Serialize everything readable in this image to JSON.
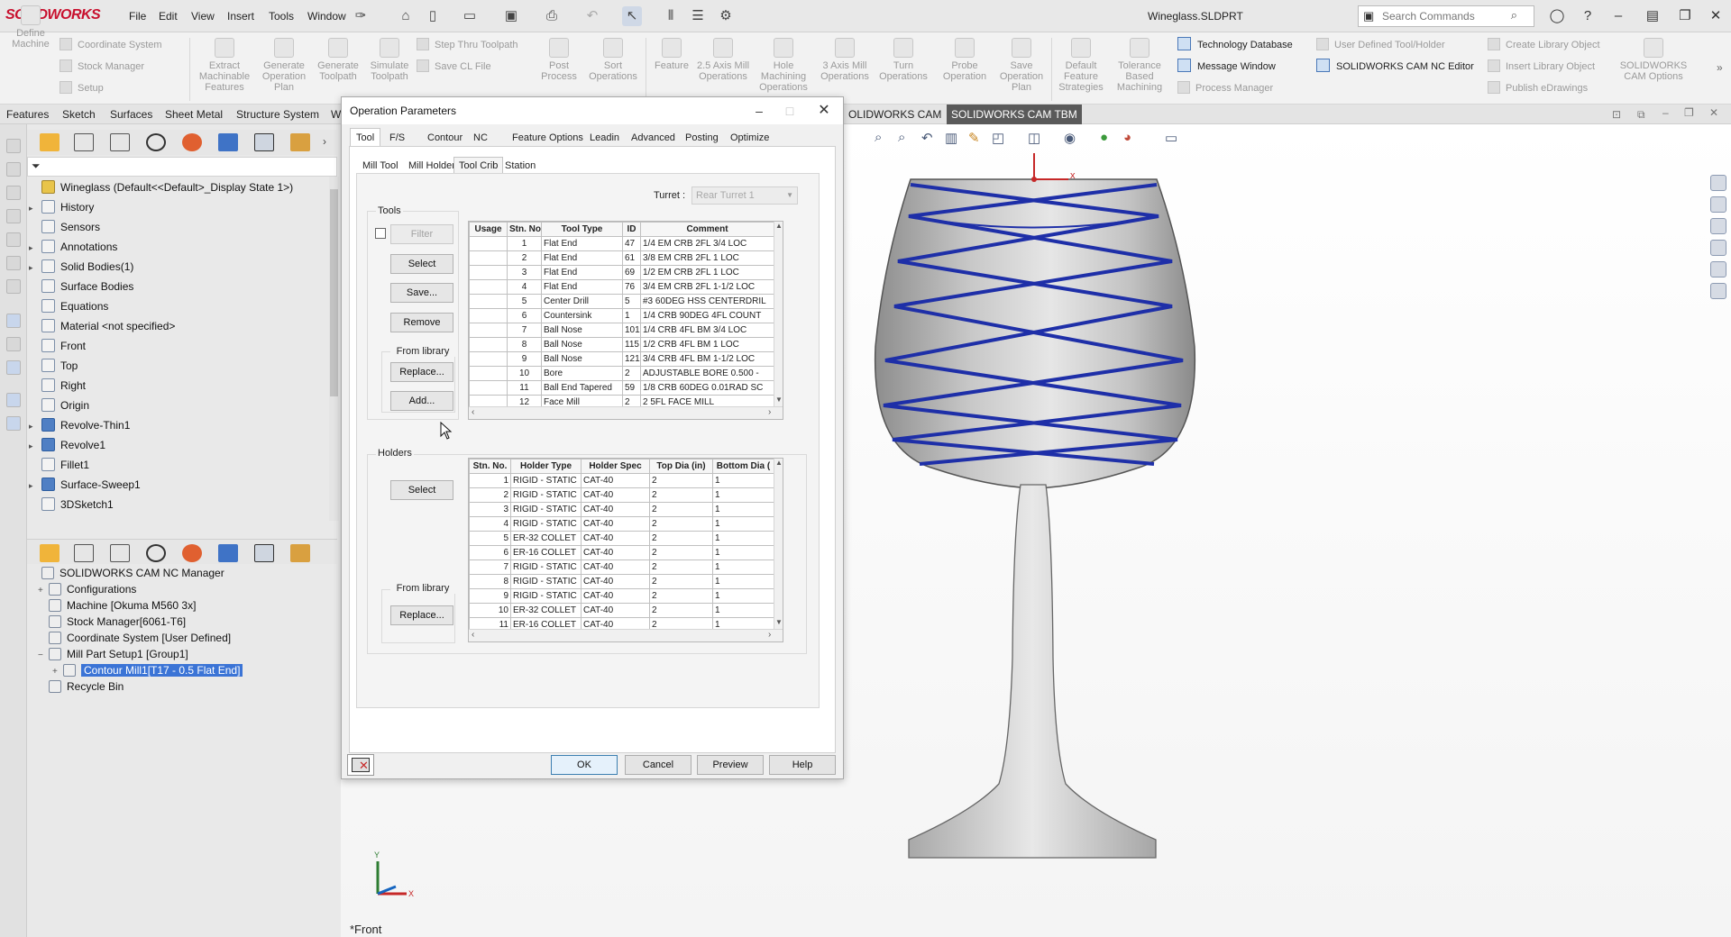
{
  "app": {
    "logo": "SOLIDWORKS",
    "file_title": "Wineglass.SLDPRT",
    "search_placeholder": "Search Commands"
  },
  "menu": [
    "File",
    "Edit",
    "View",
    "Insert",
    "Tools",
    "Window"
  ],
  "ribbon": {
    "define_machine": "Define Machine",
    "coord_system": "Coordinate System",
    "stock_manager": "Stock Manager",
    "setup": "Setup",
    "extract": "Extract Machinable Features",
    "gen_plan": "Generate Operation Plan",
    "gen_toolpath": "Generate Toolpath",
    "sim_toolpath": "Simulate Toolpath",
    "step_thru": "Step Thru Toolpath",
    "save_cl": "Save CL File",
    "post": "Post Process",
    "sort": "Sort Operations",
    "feature": "Feature",
    "mill25": "2.5 Axis Mill Operations",
    "hole": "Hole Machining Operations",
    "mill3": "3 Axis Mill Operations",
    "turn": "Turn Operations",
    "probe": "Probe Operation",
    "save_plan": "Save Operation Plan",
    "default_strat": "Default Feature Strategies",
    "tolerance": "Tolerance Based Machining",
    "tech_db": "Technology Database",
    "msg_window": "Message Window",
    "process_mgr": "Process Manager",
    "user_tool": "User Defined Tool/Holder",
    "nc_editor": "SOLIDWORKS CAM NC Editor",
    "create_lib": "Create Library Object",
    "insert_lib": "Insert Library Object",
    "publish": "Publish eDrawings",
    "cam_options": "SOLIDWORKS CAM Options"
  },
  "cmd_tabs": [
    "Features",
    "Sketch",
    "Surfaces",
    "Sheet Metal",
    "Structure System",
    "W"
  ],
  "cam_tabs": [
    "OLIDWORKS CAM",
    "SOLIDWORKS CAM TBM"
  ],
  "feature_tree": [
    {
      "label": "Wineglass  (Default<<Default>_Display State 1>)",
      "expander": "",
      "icon": "yellow"
    },
    {
      "label": "History",
      "expander": "▸",
      "icon": ""
    },
    {
      "label": "Sensors",
      "expander": "",
      "icon": ""
    },
    {
      "label": "Annotations",
      "expander": "▸",
      "icon": ""
    },
    {
      "label": "Solid Bodies(1)",
      "expander": "▸",
      "icon": ""
    },
    {
      "label": "Surface Bodies",
      "expander": "",
      "icon": ""
    },
    {
      "label": "Equations",
      "expander": "",
      "icon": ""
    },
    {
      "label": "Material <not specified>",
      "expander": "",
      "icon": ""
    },
    {
      "label": "Front",
      "expander": "",
      "icon": ""
    },
    {
      "label": "Top",
      "expander": "",
      "icon": ""
    },
    {
      "label": "Right",
      "expander": "",
      "icon": ""
    },
    {
      "label": "Origin",
      "expander": "",
      "icon": ""
    },
    {
      "label": "Revolve-Thin1",
      "expander": "▸",
      "icon": "blue"
    },
    {
      "label": "Revolve1",
      "expander": "▸",
      "icon": "blue"
    },
    {
      "label": "Fillet1",
      "expander": "",
      "icon": ""
    },
    {
      "label": "Surface-Sweep1",
      "expander": "▸",
      "icon": "blue"
    },
    {
      "label": "3DSketch1",
      "expander": "",
      "icon": ""
    }
  ],
  "cam_tree": [
    {
      "label": "SOLIDWORKS CAM NC Manager",
      "pm": "",
      "selected": false
    },
    {
      "label": "Configurations",
      "pm": "+",
      "selected": false
    },
    {
      "label": "Machine [Okuma M560 3x]",
      "pm": "",
      "selected": false
    },
    {
      "label": "Stock Manager[6061-T6]",
      "pm": "",
      "selected": false
    },
    {
      "label": "Coordinate System [User Defined]",
      "pm": "",
      "selected": false
    },
    {
      "label": "Mill Part Setup1 [Group1]",
      "pm": "−",
      "selected": false
    },
    {
      "label": "Contour Mill1[T17 - 0.5 Flat End]",
      "pm": "+",
      "selected": true
    },
    {
      "label": "Recycle Bin",
      "pm": "",
      "selected": false
    }
  ],
  "dialog": {
    "title": "Operation Parameters",
    "tabs": [
      "Tool",
      "F/S",
      "Contour",
      "NC",
      "Feature Options",
      "Leadin",
      "Advanced",
      "Posting",
      "Optimize"
    ],
    "subtabs": [
      "Mill Tool",
      "Mill Holder",
      "Tool Crib",
      "Station"
    ],
    "tools_group": "Tools",
    "holders_group": "Holders",
    "filter": "Filter",
    "select": "Select",
    "save": "Save...",
    "remove": "Remove",
    "from_library": "From library",
    "replace": "Replace...",
    "add": "Add...",
    "turret_label": "Turret :",
    "turret_value": "Rear Turret 1",
    "tool_headers": [
      "Usage",
      "Stn. No.",
      "Tool Type",
      "ID",
      "Comment"
    ],
    "tools": [
      [
        "",
        "1",
        "Flat End",
        "47",
        "1/4 EM CRB 2FL 3/4  LOC"
      ],
      [
        "",
        "2",
        "Flat End",
        "61",
        "3/8 EM CRB 2FL 1 LOC"
      ],
      [
        "",
        "3",
        "Flat End",
        "69",
        "1/2 EM CRB 2FL 1 LOC"
      ],
      [
        "",
        "4",
        "Flat End",
        "76",
        "3/4 EM CRB 2FL 1-1/2 LOC"
      ],
      [
        "",
        "5",
        "Center Drill",
        "5",
        "#3 60DEG HSS CENTERDRIL"
      ],
      [
        "",
        "6",
        "Countersink",
        "1",
        "1/4 CRB 90DEG 4FL COUNT"
      ],
      [
        "",
        "7",
        "Ball Nose",
        "101",
        "1/4 CRB 4FL BM 3/4 LOC"
      ],
      [
        "",
        "8",
        "Ball Nose",
        "115",
        "1/2 CRB 4FL BM 1 LOC"
      ],
      [
        "",
        "9",
        "Ball Nose",
        "121",
        "3/4 CRB 4FL BM 1-1/2 LOC"
      ],
      [
        "",
        "10",
        "Bore",
        "2",
        "ADJUSTABLE BORE 0.500 -"
      ],
      [
        "",
        "11",
        "Ball End Tapered",
        "59",
        "1/8 CRB 60DEG 0.01RAD SC"
      ],
      [
        "",
        "12",
        "Face Mill",
        "2",
        "2 5FL FACE MILL"
      ]
    ],
    "holder_headers": [
      "Stn. No.",
      "Holder Type",
      "Holder Spec",
      "Top Dia (in)",
      "Bottom Dia ("
    ],
    "holders": [
      [
        "1",
        "RIGID - STATIC",
        "CAT-40",
        "2",
        "1"
      ],
      [
        "2",
        "RIGID - STATIC",
        "CAT-40",
        "2",
        "1"
      ],
      [
        "3",
        "RIGID - STATIC",
        "CAT-40",
        "2",
        "1"
      ],
      [
        "4",
        "RIGID - STATIC",
        "CAT-40",
        "2",
        "1"
      ],
      [
        "5",
        "ER-32 COLLET",
        "CAT-40",
        "2",
        "1"
      ],
      [
        "6",
        "ER-16 COLLET",
        "CAT-40",
        "2",
        "1"
      ],
      [
        "7",
        "RIGID - STATIC",
        "CAT-40",
        "2",
        "1"
      ],
      [
        "8",
        "RIGID - STATIC",
        "CAT-40",
        "2",
        "1"
      ],
      [
        "9",
        "RIGID - STATIC",
        "CAT-40",
        "2",
        "1"
      ],
      [
        "10",
        "ER-32 COLLET",
        "CAT-40",
        "2",
        "1"
      ],
      [
        "11",
        "ER-16 COLLET",
        "CAT-40",
        "2",
        "1"
      ]
    ],
    "ok": "OK",
    "cancel": "Cancel",
    "preview": "Preview",
    "help": "Help"
  },
  "viewport": {
    "view_label": "*Front",
    "triad_y": "Y",
    "triad_x": "X",
    "origin_x": "x"
  },
  "colors": {
    "accent": "#3b74d6",
    "brand": "#c8102e",
    "sweep": "#1e2fa8"
  }
}
